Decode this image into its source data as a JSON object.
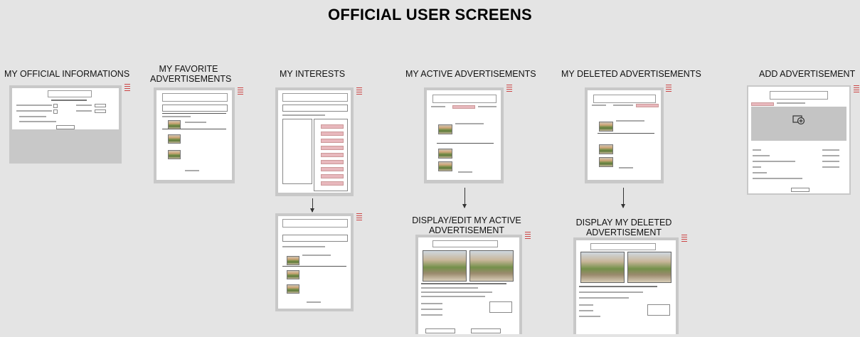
{
  "title": "OFFICIAL USER SCREENS",
  "screens": {
    "official_info": "MY OFFICIAL INFORMATIONS",
    "favorite_ads": "MY FAVORITE ADVERTISEMENTS",
    "interests": "MY INTERESTS",
    "active_ads": "MY ACTIVE ADVERTISEMENTS",
    "deleted_ads": "MY DELETED ADVERTISEMENTS",
    "add_ad": "ADD ADVERTISEMENT",
    "display_edit_active": "DISPLAY/EDIT MY ACTIVE ADVERTISEMENT",
    "display_deleted": "DISPLAY MY DELETED ADVERTISEMENT"
  },
  "colors": {
    "background": "#e4e4e4",
    "frame": "#c8c8c8",
    "accent": "#e8b8bd"
  },
  "icons": {
    "add_photo": "camera-add-icon",
    "arrow": "arrow-down-icon"
  }
}
